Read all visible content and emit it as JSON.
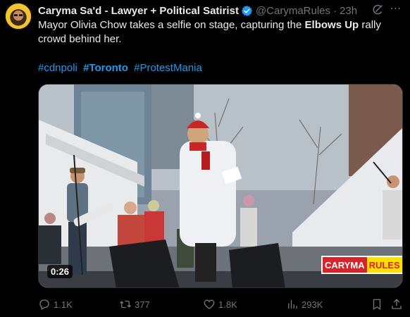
{
  "header": {
    "name": "Caryma Sa'd - Lawyer + Political Satirist",
    "handle": "@CarymaRules",
    "dot": "·",
    "time": "23h"
  },
  "tweet": {
    "text_before": "Mayor Olivia Chow takes a selfie on stage, capturing the ",
    "text_bold": "Elbows Up",
    "text_after": " rally crowd behind her.",
    "hashtags": [
      "#cdnpoli",
      "#Toronto",
      "#ProtestMania"
    ]
  },
  "video": {
    "duration": "0:26",
    "watermark_part1": "CARYMA",
    "watermark_part2": "RULES"
  },
  "actions": {
    "replies": "1.1K",
    "reposts": "377",
    "likes": "1.8K",
    "views": "293K"
  },
  "colors": {
    "background": "#000000",
    "text": "#e7e9ea",
    "muted": "#71767b",
    "link": "#1d9bf0",
    "verified": "#1d9bf0"
  },
  "icons": [
    "avatar",
    "verified-badge-icon",
    "grok-icon",
    "more-icon",
    "reply-icon",
    "repost-icon",
    "like-icon",
    "views-icon",
    "bookmark-icon",
    "share-icon"
  ]
}
